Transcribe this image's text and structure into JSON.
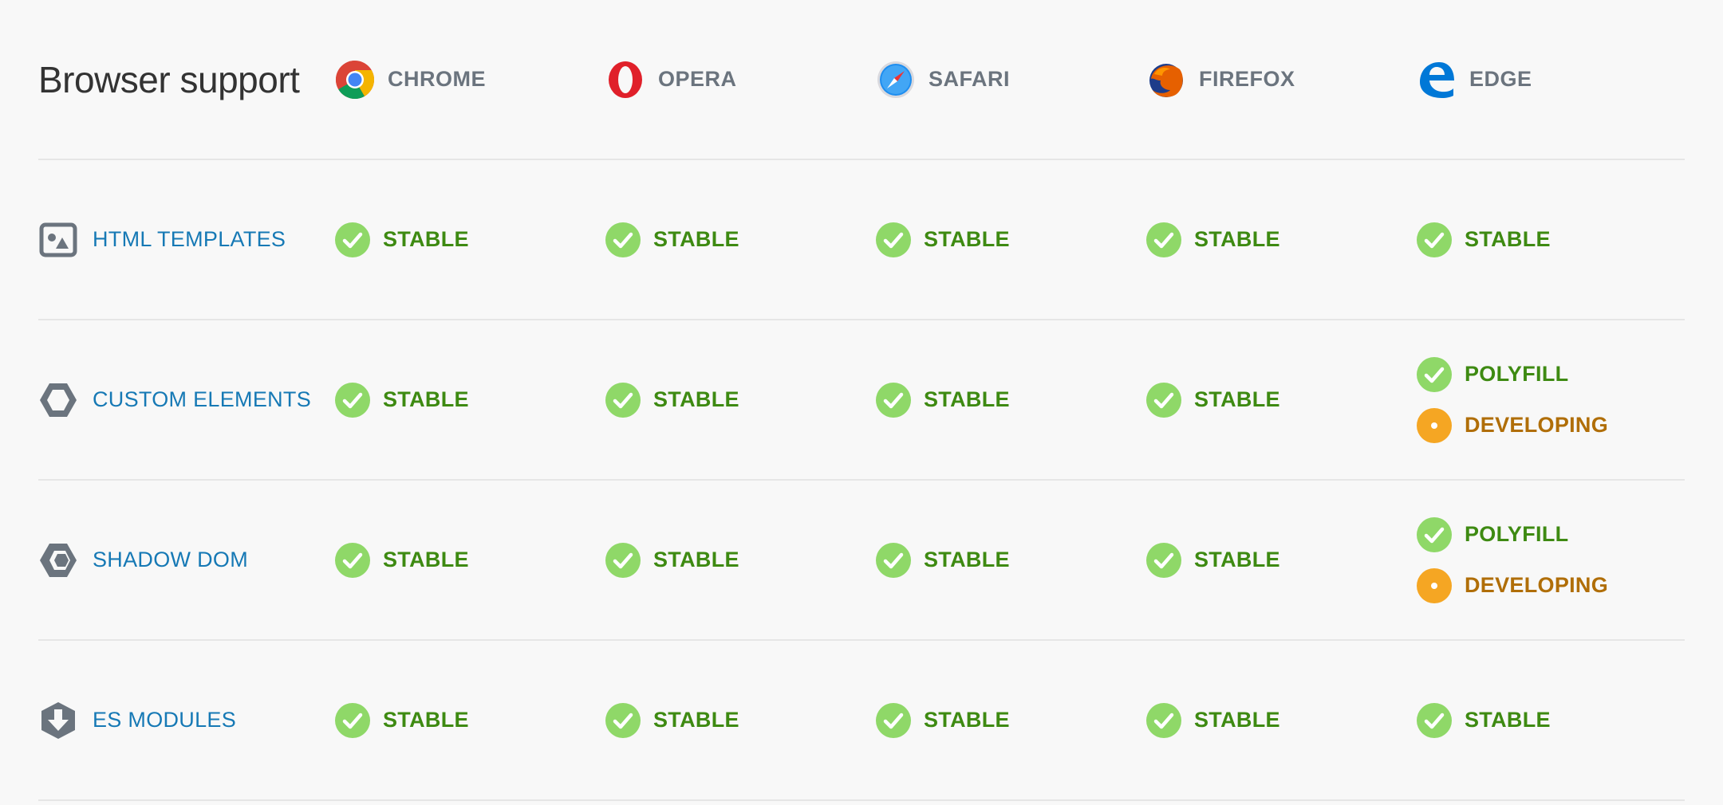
{
  "title": "Browser support",
  "browsers": [
    {
      "name": "CHROME",
      "icon": "chrome-icon"
    },
    {
      "name": "OPERA",
      "icon": "opera-icon"
    },
    {
      "name": "SAFARI",
      "icon": "safari-icon"
    },
    {
      "name": "FIREFOX",
      "icon": "firefox-icon"
    },
    {
      "name": "EDGE",
      "icon": "edge-icon"
    }
  ],
  "features": [
    {
      "name": "HTML TEMPLATES",
      "icon": "image-template-icon",
      "support": [
        [
          {
            "label": "STABLE",
            "type": "stable"
          }
        ],
        [
          {
            "label": "STABLE",
            "type": "stable"
          }
        ],
        [
          {
            "label": "STABLE",
            "type": "stable"
          }
        ],
        [
          {
            "label": "STABLE",
            "type": "stable"
          }
        ],
        [
          {
            "label": "STABLE",
            "type": "stable"
          }
        ]
      ]
    },
    {
      "name": "CUSTOM ELEMENTS",
      "icon": "hexagon-icon",
      "support": [
        [
          {
            "label": "STABLE",
            "type": "stable"
          }
        ],
        [
          {
            "label": "STABLE",
            "type": "stable"
          }
        ],
        [
          {
            "label": "STABLE",
            "type": "stable"
          }
        ],
        [
          {
            "label": "STABLE",
            "type": "stable"
          }
        ],
        [
          {
            "label": "POLYFILL",
            "type": "polyfill"
          },
          {
            "label": "DEVELOPING",
            "type": "developing"
          }
        ]
      ]
    },
    {
      "name": "SHADOW DOM",
      "icon": "shadow-hexagon-icon",
      "support": [
        [
          {
            "label": "STABLE",
            "type": "stable"
          }
        ],
        [
          {
            "label": "STABLE",
            "type": "stable"
          }
        ],
        [
          {
            "label": "STABLE",
            "type": "stable"
          }
        ],
        [
          {
            "label": "STABLE",
            "type": "stable"
          }
        ],
        [
          {
            "label": "POLYFILL",
            "type": "polyfill"
          },
          {
            "label": "DEVELOPING",
            "type": "developing"
          }
        ]
      ]
    },
    {
      "name": "ES MODULES",
      "icon": "download-hexagon-icon",
      "support": [
        [
          {
            "label": "STABLE",
            "type": "stable"
          }
        ],
        [
          {
            "label": "STABLE",
            "type": "stable"
          }
        ],
        [
          {
            "label": "STABLE",
            "type": "stable"
          }
        ],
        [
          {
            "label": "STABLE",
            "type": "stable"
          }
        ],
        [
          {
            "label": "STABLE",
            "type": "stable"
          }
        ]
      ]
    }
  ],
  "colors": {
    "stable": "#8fd868",
    "developing": "#f5a623",
    "feature_text": "#1679b5",
    "browser_text": "#6b747e"
  }
}
